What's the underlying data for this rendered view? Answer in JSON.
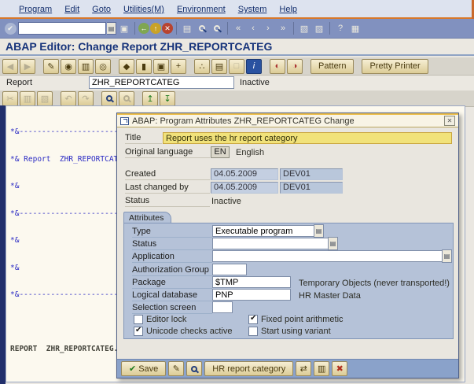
{
  "colors": {
    "accent_orange": "#d8782a",
    "toolbar_blue": "#8191bf",
    "title_text_blue": "#16337a",
    "highlight_yellow": "#f1e27a",
    "group_box_blue": "#b5c2d8",
    "footer_blue": "#8aa2ca",
    "comment_blue": "#2c2cc4",
    "editor_cream": "#fcf9ef"
  },
  "window": {
    "menu_items": [
      "Program",
      "Edit",
      "Goto",
      "Utilities(M)",
      "Environment",
      "System",
      "Help"
    ]
  },
  "standard_toolbar": {
    "command_value": "",
    "icons": [
      {
        "name": "enter",
        "glyph": "✔"
      },
      {
        "name": "save",
        "glyph": "▣"
      },
      {
        "name": "back",
        "glyph": "←"
      },
      {
        "name": "exit",
        "glyph": "↑"
      },
      {
        "name": "cancel",
        "glyph": "✕"
      },
      {
        "name": "print",
        "glyph": "▤"
      },
      {
        "name": "find",
        "glyph": "magnifier"
      },
      {
        "name": "find-next",
        "glyph": "magnifier-plus"
      },
      {
        "name": "first-page",
        "glyph": "«"
      },
      {
        "name": "previous-page",
        "glyph": "‹"
      },
      {
        "name": "next-page",
        "glyph": "›"
      },
      {
        "name": "last-page",
        "glyph": "»"
      },
      {
        "name": "new-session",
        "glyph": "▧"
      },
      {
        "name": "shortcut",
        "glyph": "▨"
      },
      {
        "name": "help",
        "glyph": "?"
      },
      {
        "name": "customize",
        "glyph": "▦"
      }
    ],
    "dropdown_icon": "▤"
  },
  "page": {
    "title": "ABAP Editor: Change Report ZHR_REPORTCATEG"
  },
  "app_toolbar": {
    "icons": [
      {
        "name": "nav-back",
        "glyph": "◀",
        "disabled": true
      },
      {
        "name": "nav-forward",
        "glyph": "▶",
        "disabled": true
      },
      {
        "name": "display-change",
        "glyph": "✎",
        "disabled": false
      },
      {
        "name": "object-list",
        "glyph": "◉",
        "disabled": false
      },
      {
        "name": "copy-program",
        "glyph": "▥",
        "disabled": false
      },
      {
        "name": "activate",
        "glyph": "◎",
        "disabled": false
      },
      {
        "name": "lock",
        "glyph": "◆",
        "disabled": false
      },
      {
        "name": "breakpoint",
        "glyph": "▮",
        "disabled": false
      },
      {
        "name": "where-used",
        "glyph": "▣",
        "disabled": false
      },
      {
        "name": "navigation",
        "glyph": "+",
        "disabled": false
      },
      {
        "name": "object-hierarchy",
        "glyph": "∴",
        "disabled": false
      },
      {
        "name": "print-source",
        "glyph": "▤",
        "disabled": false
      },
      {
        "name": "worklist",
        "glyph": "□",
        "disabled": true
      },
      {
        "name": "info",
        "glyph": "i",
        "disabled": false
      },
      {
        "name": "runtime-analysis",
        "glyph": "◐",
        "disabled": false
      },
      {
        "name": "documentation",
        "glyph": "◑",
        "disabled": false
      }
    ],
    "pattern_label": "Pattern",
    "pretty_printer_label": "Pretty Printer"
  },
  "report_row": {
    "label": "Report",
    "value": "ZHR_REPORTCATEG",
    "status": "Inactive"
  },
  "editor_toolbar": {
    "icons": [
      {
        "name": "cut",
        "glyph": "✂",
        "disabled": true
      },
      {
        "name": "copy",
        "glyph": "▥",
        "disabled": true
      },
      {
        "name": "paste",
        "glyph": "▧",
        "disabled": true
      },
      {
        "name": "undo",
        "glyph": "↶",
        "disabled": true
      },
      {
        "name": "redo",
        "glyph": "↷",
        "disabled": true
      },
      {
        "name": "find",
        "glyph": "magnifier",
        "disabled": false
      },
      {
        "name": "find-next",
        "glyph": "magnifier",
        "disabled": true
      },
      {
        "name": "upload",
        "glyph": "↥",
        "disabled": false
      },
      {
        "name": "download",
        "glyph": "↧",
        "disabled": false
      }
    ]
  },
  "editor": {
    "lines": [
      {
        "text": "*&---------------------------------------------------------------------*",
        "type": "comment"
      },
      {
        "text": "*& Report  ZHR_REPORTCATEG",
        "type": "comment"
      },
      {
        "text": "*&",
        "type": "comment"
      },
      {
        "text": "*&---------------------------------------------------------------------*",
        "type": "comment"
      },
      {
        "text": "*&",
        "type": "comment"
      },
      {
        "text": "*&",
        "type": "comment"
      },
      {
        "text": "*&---------------------------------------------------------------------*",
        "type": "comment"
      },
      {
        "text": "",
        "type": "blank"
      },
      {
        "text": "REPORT  ZHR_REPORTCATEG.",
        "type": "code"
      }
    ]
  },
  "dialog": {
    "title": "ABAP: Program Attributes ZHR_REPORTCATEG Change",
    "close_glyph": "✕",
    "fields": {
      "title_label": "Title",
      "title_value": "Report uses the hr report category",
      "orig_lang_label": "Original language",
      "orig_lang_value": "EN",
      "orig_lang_text": "English",
      "created_label": "Created",
      "created_date": "04.05.2009",
      "created_user": "DEV01",
      "changed_label": "Last changed by",
      "changed_date": "04.05.2009",
      "changed_user": "DEV01",
      "status_label": "Status",
      "status_value": "Inactive"
    },
    "attributes": {
      "tab_label": "Attributes",
      "type_label": "Type",
      "type_value": "Executable program",
      "status_label": "Status",
      "status_value": "",
      "application_label": "Application",
      "application_value": "",
      "auth_group_label": "Authorization Group",
      "auth_group_value": "",
      "package_label": "Package",
      "package_value": "$TMP",
      "package_desc": "Temporary Objects (never transported!)",
      "logical_db_label": "Logical database",
      "logical_db_value": "PNP",
      "logical_db_desc": "HR Master Data",
      "selection_screen_label": "Selection screen",
      "selection_screen_value": "",
      "checkboxes": [
        {
          "label": "Editor lock",
          "checked": false
        },
        {
          "label": "Fixed point arithmetic",
          "checked": true
        },
        {
          "label": "Unicode checks active",
          "checked": true
        },
        {
          "label": "Start using variant",
          "checked": false
        }
      ]
    },
    "footer": {
      "save_label": "Save",
      "save_check_glyph": "✔",
      "hr_report_category_label": "HR report category",
      "icons": [
        {
          "name": "navigate",
          "glyph": "⇄"
        },
        {
          "name": "copy-attributes",
          "glyph": "▥"
        },
        {
          "name": "close",
          "glyph": "✖"
        }
      ]
    }
  }
}
